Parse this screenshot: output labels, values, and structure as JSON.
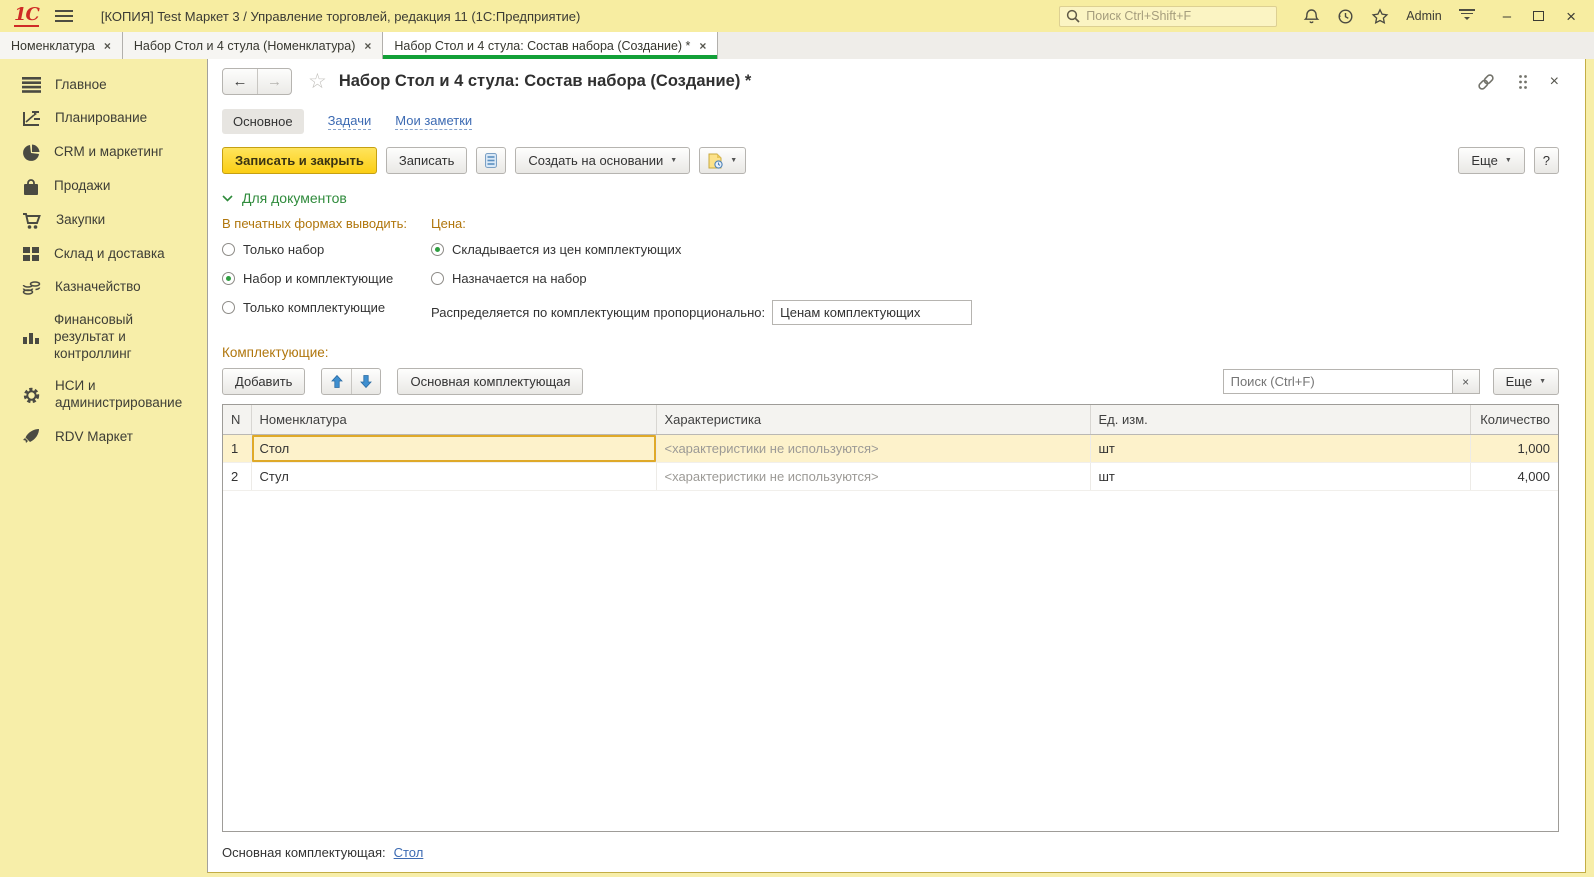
{
  "glyphs": {
    "caret": "▼",
    "close": "×",
    "back": "←",
    "forward": "→",
    "star": "☆",
    "minimize": "–",
    "help": "?"
  },
  "window": {
    "logo": "1С",
    "title": "[КОПИЯ] Test Маркет 3 / Управление торговлей, редакция 11  (1С:Предприятие)",
    "search_placeholder": "Поиск Ctrl+Shift+F",
    "user": "Admin",
    "icons": [
      "hamburger-icon",
      "search-icon",
      "bell-icon",
      "history-icon",
      "star-icon",
      "main-menu-icon",
      "minimize-icon",
      "maximize-icon",
      "close-icon"
    ]
  },
  "tabs": [
    {
      "label": "Номенклатура"
    },
    {
      "label": "Набор Стол и 4 стула (Номенклатура)"
    },
    {
      "label": "Набор Стол и 4 стула: Состав набора (Создание) *"
    }
  ],
  "sidebar": {
    "items": [
      {
        "label": "Главное",
        "icon": "menu-lines-icon"
      },
      {
        "label": "Планирование",
        "icon": "planning-chart-icon"
      },
      {
        "label": "CRM и маркетинг",
        "icon": "pie-chart-icon"
      },
      {
        "label": "Продажи",
        "icon": "shopping-bag-icon"
      },
      {
        "label": "Закупки",
        "icon": "shopping-cart-icon"
      },
      {
        "label": "Склад и доставка",
        "icon": "warehouse-boxes-icon"
      },
      {
        "label": "Казначейство",
        "icon": "coins-icon"
      },
      {
        "label": "Финансовый результат и контроллинг",
        "icon": "bar-chart-icon"
      },
      {
        "label": "НСИ и администрирование",
        "icon": "gear-icon"
      },
      {
        "label": "RDV Маркет",
        "icon": "rocket-icon"
      }
    ]
  },
  "content": {
    "header": {
      "title": "Набор Стол и 4 стула: Состав набора (Создание) *",
      "icons": [
        "back-icon",
        "forward-icon",
        "favorite-star-icon",
        "link-icon",
        "more-dots-icon",
        "close-icon"
      ]
    },
    "nav_tabs": {
      "main": "Основное",
      "tasks": "Задачи",
      "notes": "Мои заметки"
    },
    "toolbar": {
      "save_close": "Записать и закрыть",
      "save": "Записать",
      "create_based_on": "Создать на основании",
      "more": "Еще",
      "icons": [
        "report-icon",
        "document-clock-icon"
      ]
    },
    "section": {
      "header": "Для документов",
      "print_label": "В печатных формах выводить:",
      "print_options": [
        {
          "label": "Только набор",
          "selected": false
        },
        {
          "label": "Набор и комплектующие",
          "selected": true
        },
        {
          "label": "Только комплектующие",
          "selected": false
        }
      ],
      "price_label": "Цена:",
      "price_options": [
        {
          "label": "Складывается из цен комплектующих",
          "selected": true
        },
        {
          "label": "Назначается на набор",
          "selected": false
        }
      ],
      "distribute_label": "Распределяется по комплектующим пропорционально:",
      "distribute_value": "Ценам комплектующих"
    },
    "components": {
      "label": "Комплектующие:",
      "add_button": "Добавить",
      "main_component_button": "Основная комплектующая",
      "search_placeholder": "Поиск (Ctrl+F)",
      "more_button": "Еще",
      "icons": [
        "move-up-icon",
        "move-down-icon",
        "clear-search-icon"
      ],
      "table": {
        "columns": {
          "n": "N",
          "nomenclature": "Номенклатура",
          "characteristic": "Характеристика",
          "unit": "Ед. изм.",
          "qty": "Количество"
        },
        "rows": [
          {
            "n": "1",
            "nomenclature": "Стол",
            "characteristic": "<характеристики не используются>",
            "unit": "шт",
            "qty": "1,000",
            "selected": true
          },
          {
            "n": "2",
            "nomenclature": "Стул",
            "characteristic": "<характеристики не используются>",
            "unit": "шт",
            "qty": "4,000",
            "selected": false
          }
        ]
      },
      "footer_label": "Основная комплектующая:",
      "footer_value": "Стол"
    },
    "colors": {
      "accent_green": "#12a038",
      "section_green": "#2f8b3c",
      "label_amber": "#b0760c",
      "selection_yellow": "#fdf2cb",
      "active_cell_border": "#dfa928",
      "link_blue": "#3d6bb3",
      "titlebar_yellow": "#f7eda1"
    }
  }
}
